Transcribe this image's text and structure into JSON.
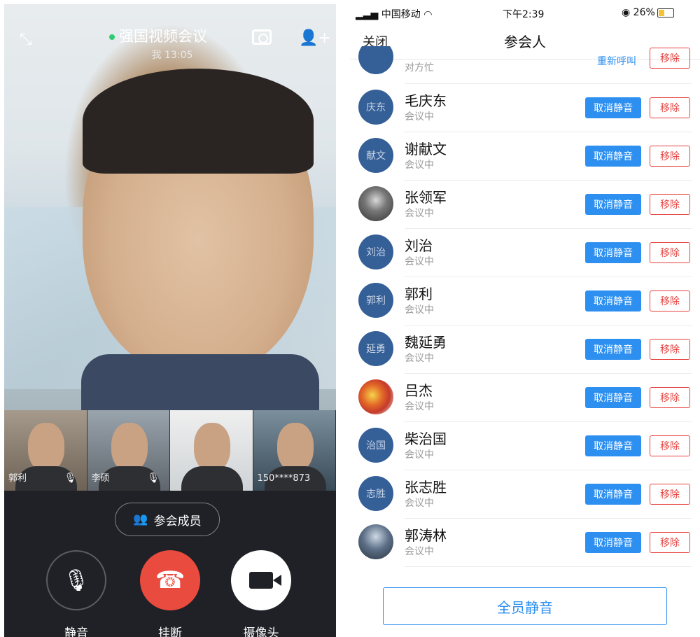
{
  "call": {
    "title": "强国视频会议",
    "subtitle": "我 13:05",
    "thumbnails": [
      {
        "name": "郭利",
        "muted": true
      },
      {
        "name": "李硕",
        "muted": true
      },
      {
        "name": "",
        "muted": false
      },
      {
        "name": "150****873",
        "muted": false
      }
    ],
    "members_label": "参会成员",
    "controls": {
      "mute_label": "静音",
      "hangup_label": "挂断",
      "camera_label": "摄像头"
    }
  },
  "status_bar": {
    "carrier": "中国移动",
    "time": "下午2:39",
    "battery": "26%"
  },
  "panel": {
    "close_label": "关闭",
    "title": "参会人",
    "participants": [
      {
        "name": "",
        "avatar_text": "",
        "status": "对方忙",
        "action1": "重新呼叫",
        "action2": "移除"
      },
      {
        "name": "毛庆东",
        "avatar_text": "庆东",
        "status": "会议中",
        "action1": "取消静音",
        "action2": "移除"
      },
      {
        "name": "谢献文",
        "avatar_text": "献文",
        "status": "会议中",
        "action1": "取消静音",
        "action2": "移除"
      },
      {
        "name": "张领军",
        "avatar_text": "",
        "status": "会议中",
        "action1": "取消静音",
        "action2": "移除"
      },
      {
        "name": "刘治",
        "avatar_text": "刘治",
        "status": "会议中",
        "action1": "取消静音",
        "action2": "移除"
      },
      {
        "name": "郭利",
        "avatar_text": "郭利",
        "status": "会议中",
        "action1": "取消静音",
        "action2": "移除"
      },
      {
        "name": "魏延勇",
        "avatar_text": "延勇",
        "status": "会议中",
        "action1": "取消静音",
        "action2": "移除"
      },
      {
        "name": "吕杰",
        "avatar_text": "",
        "status": "会议中",
        "action1": "取消静音",
        "action2": "移除"
      },
      {
        "name": "柴治国",
        "avatar_text": "治国",
        "status": "会议中",
        "action1": "取消静音",
        "action2": "移除"
      },
      {
        "name": "张志胜",
        "avatar_text": "志胜",
        "status": "会议中",
        "action1": "取消静音",
        "action2": "移除"
      },
      {
        "name": "郭涛林",
        "avatar_text": "",
        "status": "会议中",
        "action1": "取消静音",
        "action2": "移除"
      }
    ],
    "mute_all_label": "全员静音"
  },
  "colors": {
    "accent_blue": "#2d8ff0",
    "danger_red": "#e5413e",
    "hangup_red": "#ea4b3f",
    "online_green": "#2ecc71"
  }
}
